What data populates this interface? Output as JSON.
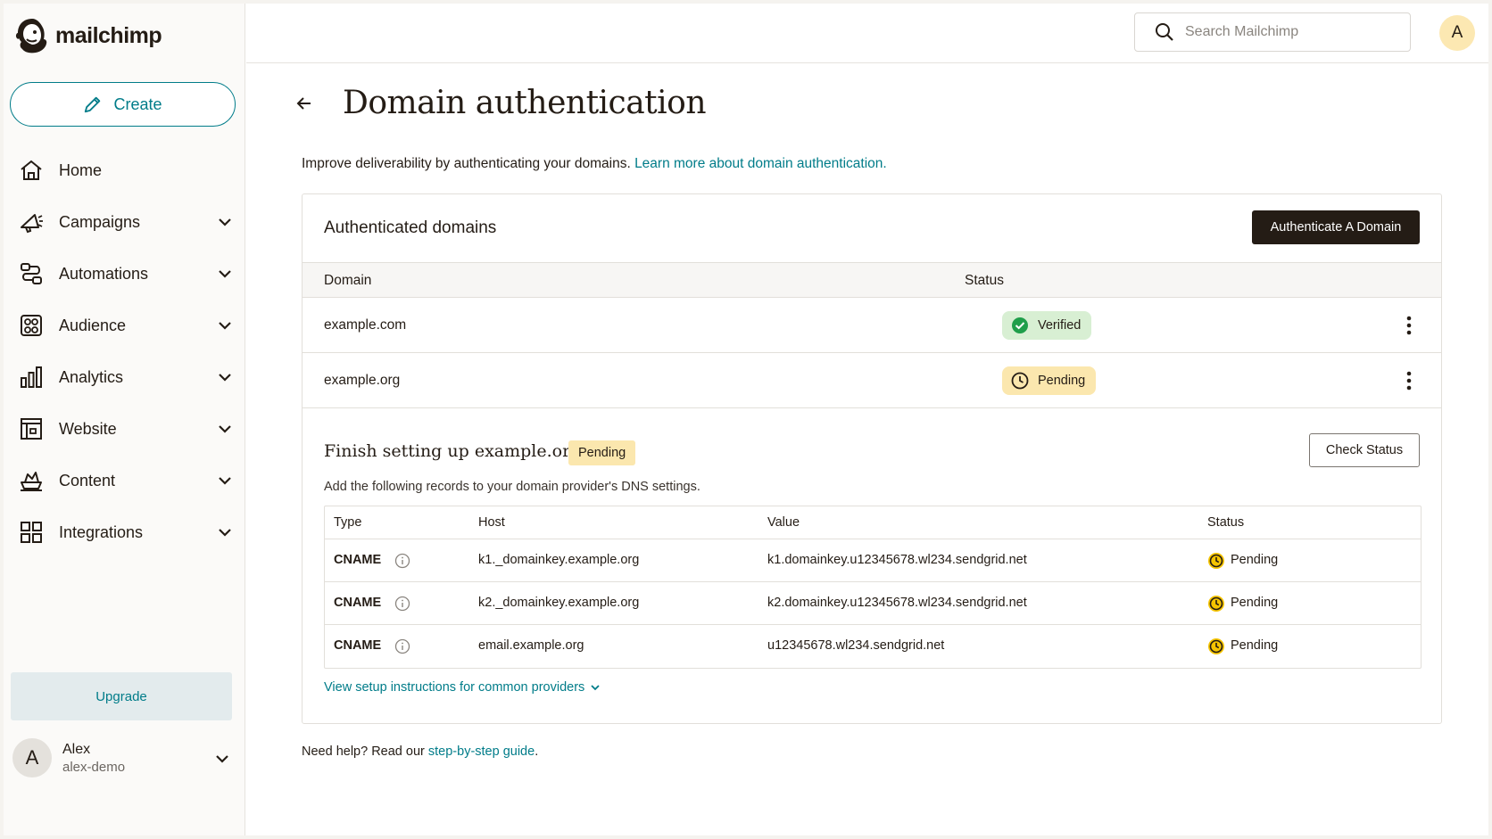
{
  "brand": {
    "name": "mailchimp",
    "accent": "#007c89",
    "dark": "#241c15"
  },
  "sidebar": {
    "create_label": "Create",
    "items": [
      {
        "label": "Home",
        "icon": "home-icon",
        "has_chevron": false
      },
      {
        "label": "Campaigns",
        "icon": "megaphone-icon",
        "has_chevron": true
      },
      {
        "label": "Automations",
        "icon": "workflow-icon",
        "has_chevron": true
      },
      {
        "label": "Audience",
        "icon": "audience-icon",
        "has_chevron": true
      },
      {
        "label": "Analytics",
        "icon": "bar-chart-icon",
        "has_chevron": true
      },
      {
        "label": "Website",
        "icon": "website-icon",
        "has_chevron": true
      },
      {
        "label": "Content",
        "icon": "content-icon",
        "has_chevron": true
      },
      {
        "label": "Integrations",
        "icon": "grid-icon",
        "has_chevron": true
      }
    ],
    "upgrade_label": "Upgrade",
    "user": {
      "initial": "A",
      "name": "Alex",
      "handle": "alex-demo"
    }
  },
  "topbar": {
    "search_placeholder": "Search Mailchimp",
    "avatar_initial": "A"
  },
  "page": {
    "title": "Domain authentication",
    "intro_text": "Improve deliverability by authenticating your domains.",
    "intro_link": "Learn more about domain authentication.",
    "help_text": "Need help? Read our",
    "help_link": "step-by-step guide",
    "help_suffix": "."
  },
  "domains": {
    "title": "Authenticated domains",
    "authenticate_button": "Authenticate A Domain",
    "columns": [
      "Domain",
      "Status"
    ],
    "rows": [
      {
        "domain": "example.com",
        "status": "Verified"
      },
      {
        "domain": "example.org",
        "status": "Pending"
      }
    ]
  },
  "setup": {
    "title_prefix": "Finish setting up",
    "domain": "example.org",
    "badge": "Pending",
    "check_button": "Check Status",
    "description": "Add the following records to your domain provider's DNS settings.",
    "columns": [
      "Type",
      "Host",
      "Value",
      "Status"
    ],
    "records": [
      {
        "type": "CNAME",
        "host": "k1._domainkey.example.org",
        "value": "k1.domainkey.u12345678.wl234.sendgrid.net",
        "status": "Pending"
      },
      {
        "type": "CNAME",
        "host": "k2._domainkey.example.org",
        "value": "k2.domainkey.u12345678.wl234.sendgrid.net",
        "status": "Pending"
      },
      {
        "type": "CNAME",
        "host": "email.example.org",
        "value": "u12345678.wl234.sendgrid.net",
        "status": "Pending"
      }
    ],
    "instructions_link": "View setup instructions for common providers"
  }
}
